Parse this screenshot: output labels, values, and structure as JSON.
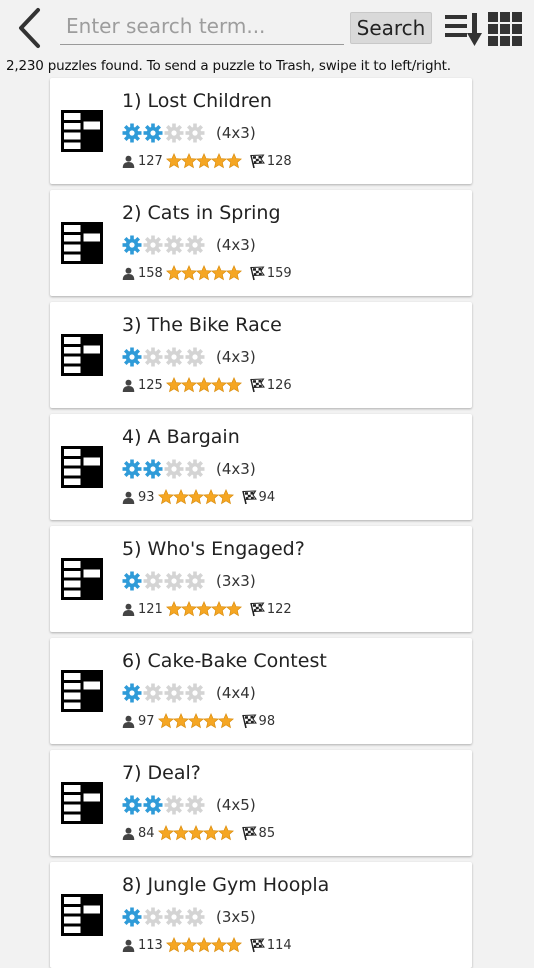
{
  "header": {
    "search_placeholder": "Enter search term...",
    "search_button": "Search"
  },
  "info_text": "2,230 puzzles found. To send a puzzle to Trash, swipe it to left/right.",
  "colors": {
    "gear_on": "#2f9bd8",
    "gear_off": "#d4d4d4",
    "star": "#f5a623",
    "background": "#f2f2f2"
  },
  "puzzles": [
    {
      "title": "1) Lost Children",
      "difficulty": 2,
      "size": "(4x3)",
      "players": "127",
      "rating": 5,
      "finished": "128"
    },
    {
      "title": "2) Cats in Spring",
      "difficulty": 1,
      "size": "(4x3)",
      "players": "158",
      "rating": 5,
      "finished": "159"
    },
    {
      "title": "3) The Bike Race",
      "difficulty": 1,
      "size": "(4x3)",
      "players": "125",
      "rating": 5,
      "finished": "126"
    },
    {
      "title": "4) A Bargain",
      "difficulty": 2,
      "size": "(4x3)",
      "players": "93",
      "rating": 5,
      "finished": "94"
    },
    {
      "title": "5) Who's Engaged?",
      "difficulty": 1,
      "size": "(3x3)",
      "players": "121",
      "rating": 5,
      "finished": "122"
    },
    {
      "title": "6) Cake-Bake Contest",
      "difficulty": 1,
      "size": "(4x4)",
      "players": "97",
      "rating": 5,
      "finished": "98"
    },
    {
      "title": "7) Deal?",
      "difficulty": 2,
      "size": "(4x5)",
      "players": "84",
      "rating": 5,
      "finished": "85"
    },
    {
      "title": "8) Jungle Gym Hoopla",
      "difficulty": 1,
      "size": "(3x5)",
      "players": "113",
      "rating": 5,
      "finished": "114"
    }
  ]
}
